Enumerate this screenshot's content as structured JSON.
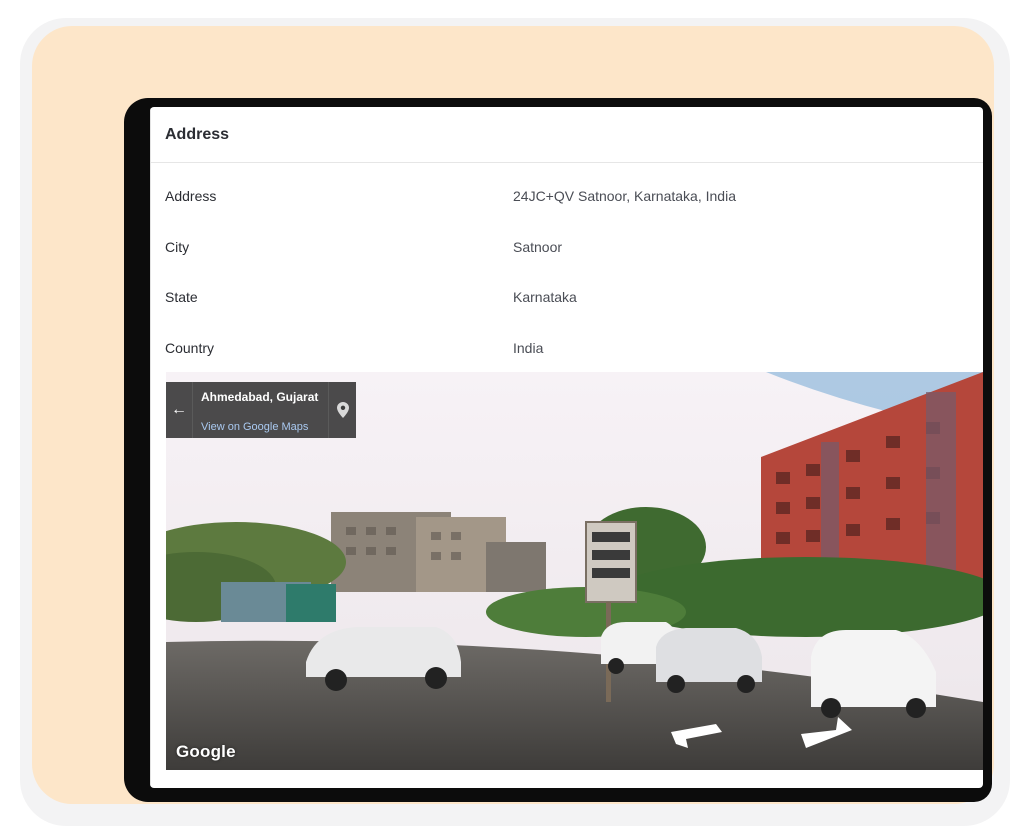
{
  "section": {
    "title": "Address"
  },
  "details": [
    {
      "label": "Address",
      "value": "24JC+QV Satnoor, Karnataka, India"
    },
    {
      "label": "City",
      "value": "Satnoor"
    },
    {
      "label": "State",
      "value": "Karnataka"
    },
    {
      "label": "Country",
      "value": "India"
    }
  ],
  "streetview": {
    "place_name": "Ahmedabad, Gujarat",
    "link_text": "View on Google Maps",
    "back_icon": "arrow-left-icon",
    "pin_icon": "map-pin-icon",
    "logo_text": "Google"
  },
  "colors": {
    "peach_background": "#fde6c9",
    "device_bezel": "#0c0c0c",
    "link_blue": "#a9c9f0"
  }
}
